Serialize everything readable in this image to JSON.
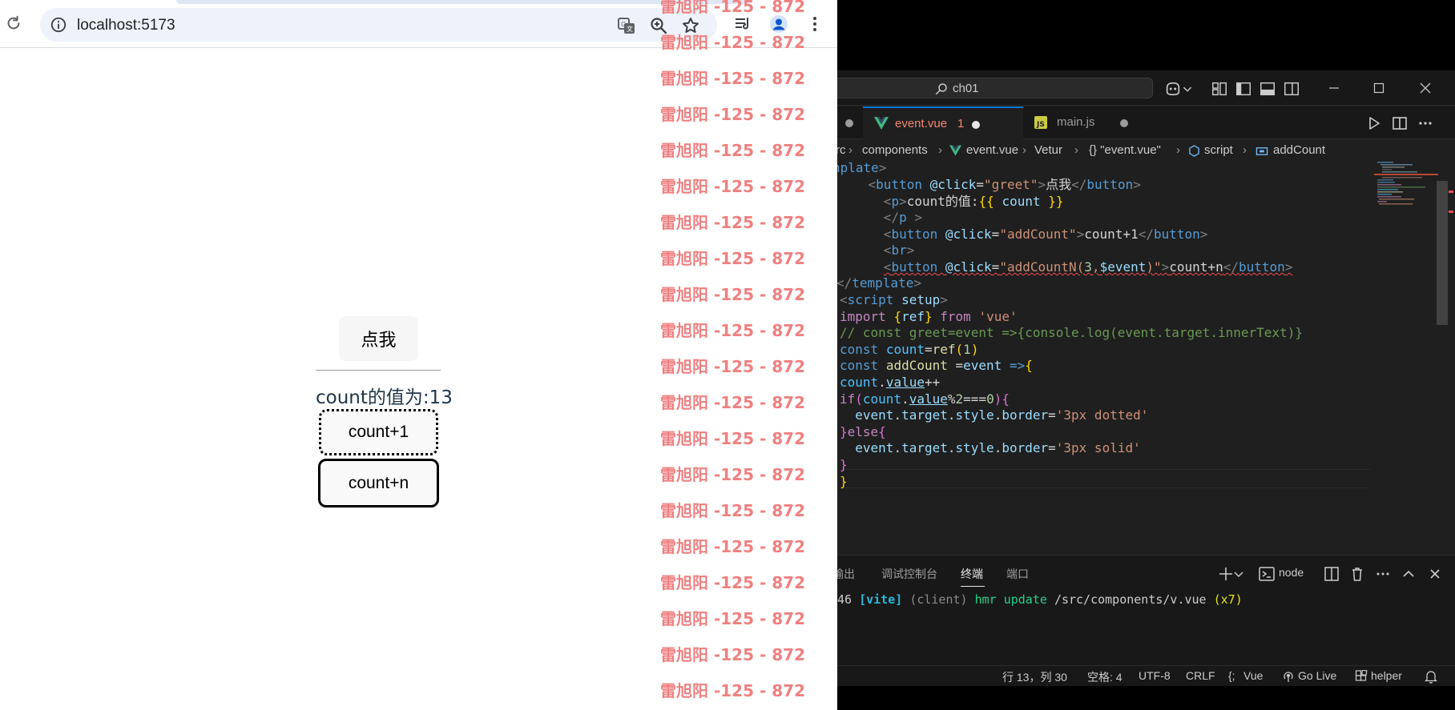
{
  "browser": {
    "url": "localhost:5173",
    "page": {
      "greet_button": "点我",
      "count_text": "count的值为:13",
      "count_plus_one_button": "count+1",
      "count_plus_n_button": "count+n"
    },
    "watermark": {
      "text": "雷旭阳 -125 - 872",
      "color": "#f08080"
    }
  },
  "vscode": {
    "command_center": "ch01",
    "tabs": [
      {
        "label": "event.vue",
        "badge": "1",
        "modified": true,
        "active": true,
        "icon": "vue-icon"
      },
      {
        "label": "main.js",
        "modified": true,
        "active": false,
        "icon": "js-icon"
      }
    ],
    "breadcrumb": {
      "items": [
        "rc",
        "components",
        "event.vue",
        "Vetur",
        "{} \"event.vue\"",
        "script",
        "addCount"
      ]
    },
    "code_lines": [
      "nplate>",
      "  <button @click=\"greet\">点我</button>",
      "    <p>count的值:{{ count }}",
      "    </p >",
      "    <button @click=\"addCount\">count+1</button>",
      "    <br>",
      "    <button @click=\"addCountN(3,$event)\">count+n</button>",
      "</template>",
      "<script setup>",
      "import {ref} from 'vue'",
      "// const greet=event =>{console.log(event.target.innerText)}",
      "const count=ref(1)",
      "const addCount =event =>{",
      "count.value++",
      "if(count.value%2===0){",
      "  event.target.style.border='3px dotted'",
      "}else{",
      "  event.target.style.border='3px solid'",
      "}",
      "}"
    ],
    "panel": {
      "tabs": [
        "输出",
        "调试控制台",
        "终端",
        "端口"
      ],
      "active_tab": "终端",
      "terminal_name": "node",
      "terminal_line": {
        "prefix": "46 ",
        "tag": "[vite]",
        "client": "(client)",
        "action": "hmr update",
        "path": "/src/components/v.vue",
        "count": "(x7)"
      }
    },
    "statusbar": {
      "position": "行 13，列 30",
      "spaces": "空格: 4",
      "encoding": "UTF-8",
      "eol": "CRLF",
      "language": "Vue",
      "golive": "Go Live",
      "helper": "helper"
    },
    "colors": {
      "editor_bg": "#1f1f1f",
      "chrome_bg": "#181818",
      "accent": "#0078d4"
    }
  }
}
